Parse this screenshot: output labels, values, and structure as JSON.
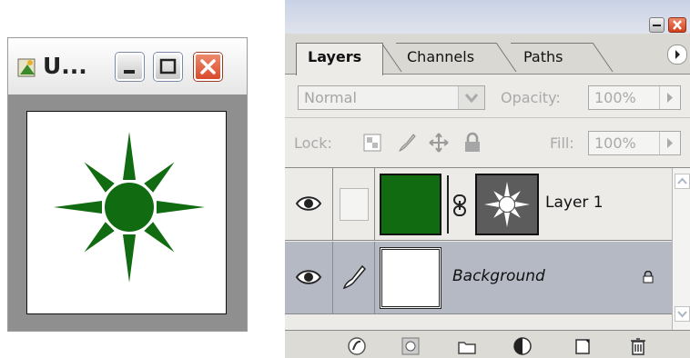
{
  "document_window": {
    "title": "U...",
    "art_color": "#116b11"
  },
  "layers_palette": {
    "tabs": [
      {
        "label": "Layers",
        "active": true
      },
      {
        "label": "Channels",
        "active": false
      },
      {
        "label": "Paths",
        "active": false
      }
    ],
    "blend_mode": "Normal",
    "opacity_label": "Opacity:",
    "opacity_value": "100%",
    "lock_label": "Lock:",
    "fill_label": "Fill:",
    "fill_value": "100%",
    "layers": [
      {
        "name": "Layer 1",
        "visible": true,
        "selected": false,
        "thumb_color": "#116b11"
      },
      {
        "name": "Background",
        "visible": true,
        "selected": true,
        "locked": true
      }
    ]
  },
  "colors": {
    "selection": "#b5b9c4",
    "panel": "#ecebe8",
    "close_red": "#d84a2a"
  }
}
